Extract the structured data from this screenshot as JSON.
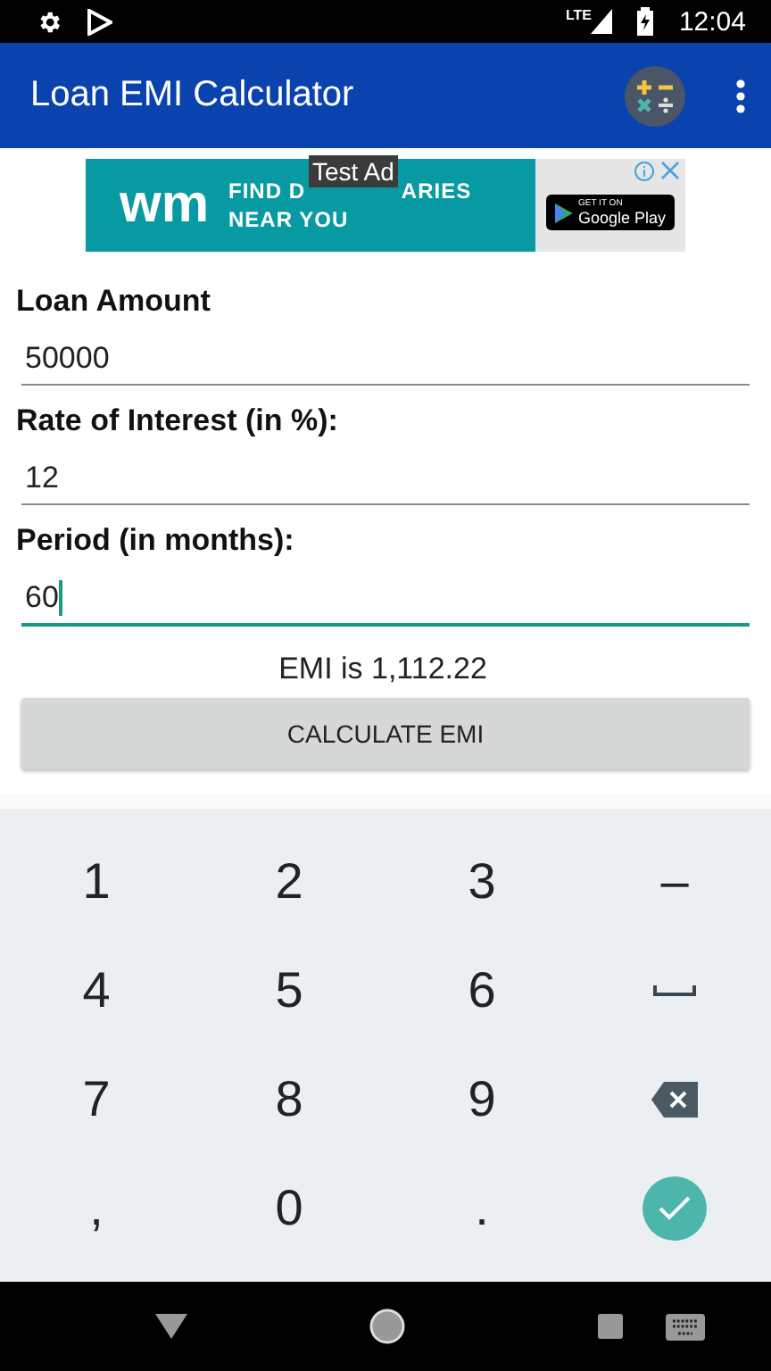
{
  "status_bar": {
    "time": "12:04",
    "network": "LTE"
  },
  "app_bar": {
    "title": "Loan EMI Calculator"
  },
  "ad": {
    "logo": "wm",
    "headline_start": "FIND D",
    "headline_end": "ARIES",
    "headline_line2": "NEAR YOU",
    "badge": "Test Ad",
    "store_small": "GET IT ON",
    "store": "Google Play"
  },
  "fields": [
    {
      "label": "Loan Amount",
      "value": "50000",
      "focused": false
    },
    {
      "label": "Rate of Interest (in %):",
      "value": "12",
      "focused": false
    },
    {
      "label": "Period (in months):",
      "value": "60",
      "focused": true
    }
  ],
  "result": "EMI is 1,112.22",
  "calculate_button": "CALCULATE EMI",
  "keyboard": [
    {
      "kind": "text",
      "label": "1"
    },
    {
      "kind": "text",
      "label": "2"
    },
    {
      "kind": "text",
      "label": "3"
    },
    {
      "kind": "text",
      "label": "–"
    },
    {
      "kind": "text",
      "label": "4"
    },
    {
      "kind": "text",
      "label": "5"
    },
    {
      "kind": "text",
      "label": "6"
    },
    {
      "kind": "space"
    },
    {
      "kind": "text",
      "label": "7"
    },
    {
      "kind": "text",
      "label": "8"
    },
    {
      "kind": "text",
      "label": "9"
    },
    {
      "kind": "backspace"
    },
    {
      "kind": "text",
      "label": ","
    },
    {
      "kind": "text",
      "label": "0"
    },
    {
      "kind": "text",
      "label": "."
    },
    {
      "kind": "done"
    }
  ]
}
